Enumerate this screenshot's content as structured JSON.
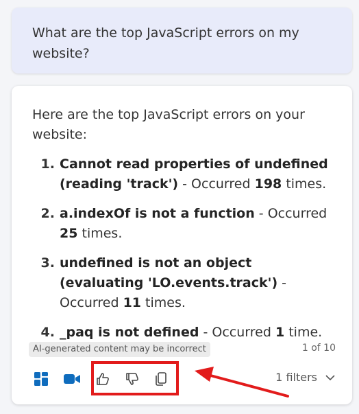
{
  "user_message": {
    "text": "What are the top JavaScript errors on my website?"
  },
  "response": {
    "intro": "Here are the top JavaScript errors on your website:",
    "errors": [
      {
        "number": "1.",
        "name": "Cannot read properties of undefined (reading 'track')",
        "pre": " - Occurred ",
        "count": "198",
        "post": " times."
      },
      {
        "number": "2.",
        "name": "a.indexOf is not a function",
        "pre": " - Occurred ",
        "count": "25",
        "post": " times."
      },
      {
        "number": "3.",
        "name": "undefined is not an object (evaluating 'LO.events.track')",
        "pre": " - Occurred ",
        "count": "11",
        "post": " times."
      },
      {
        "number": "4.",
        "name": "_paq is not defined",
        "pre": " - Occurred ",
        "count": "1",
        "post": " time."
      }
    ],
    "disclaimer": "AI-generated content may be incorrect",
    "page_count": "1 of 10"
  },
  "toolbar": {
    "icons": [
      "dashboard-icon",
      "video-icon",
      "thumbs-up-icon",
      "thumbs-down-icon",
      "copy-icon"
    ],
    "filters_label": "1 filters"
  },
  "colors": {
    "accent": "#0f6cbd",
    "highlight": "#e21b1b",
    "user_bubble": "#e8ebfa"
  }
}
